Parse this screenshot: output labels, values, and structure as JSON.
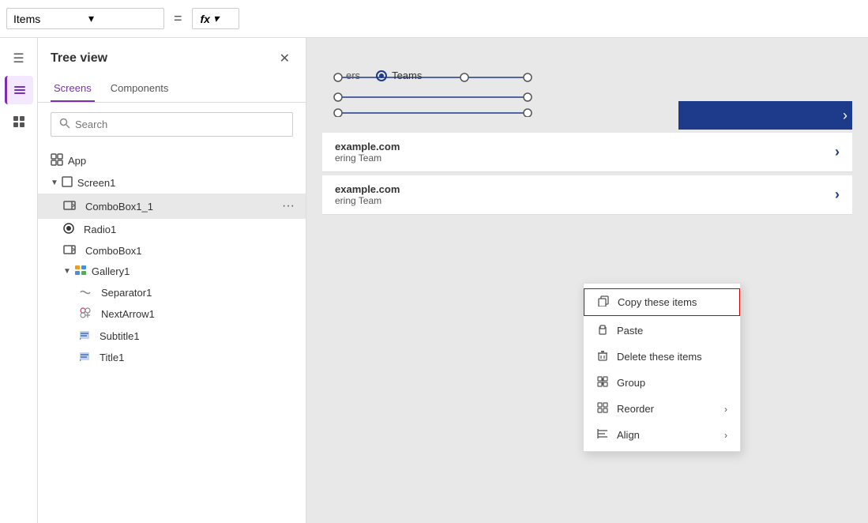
{
  "topbar": {
    "items_label": "Items",
    "dropdown_arrow": "▾",
    "equals": "=",
    "fx_label": "fx",
    "fx_arrow": "▾"
  },
  "tree_view": {
    "title": "Tree view",
    "tabs": [
      {
        "label": "Screens",
        "active": true
      },
      {
        "label": "Components",
        "active": false
      }
    ],
    "search_placeholder": "Search",
    "close_label": "✕",
    "items": [
      {
        "id": "app",
        "label": "App",
        "indent": 0,
        "type": "app",
        "icon": "⊞",
        "triangle": ""
      },
      {
        "id": "screen1",
        "label": "Screen1",
        "indent": 0,
        "type": "screen",
        "icon": "□",
        "triangle": "▼"
      },
      {
        "id": "combobox1_1",
        "label": "ComboBox1_1",
        "indent": 1,
        "type": "combobox",
        "icon": "⊟",
        "triangle": "",
        "more": "..."
      },
      {
        "id": "radio1",
        "label": "Radio1",
        "indent": 1,
        "type": "radio",
        "icon": "◉",
        "triangle": ""
      },
      {
        "id": "combobox1",
        "label": "ComboBox1",
        "indent": 1,
        "type": "combobox",
        "icon": "⊟",
        "triangle": ""
      },
      {
        "id": "gallery1",
        "label": "Gallery1",
        "indent": 1,
        "type": "gallery",
        "icon": "▦",
        "triangle": "▼"
      },
      {
        "id": "separator1",
        "label": "Separator1",
        "indent": 2,
        "type": "separator",
        "icon": "⋯",
        "triangle": ""
      },
      {
        "id": "nextarrow1",
        "label": "NextArrow1",
        "indent": 2,
        "type": "arrow",
        "icon": "✦",
        "triangle": ""
      },
      {
        "id": "subtitle1",
        "label": "Subtitle1",
        "indent": 2,
        "type": "subtitle",
        "icon": "✎",
        "triangle": ""
      },
      {
        "id": "title1",
        "label": "Title1",
        "indent": 2,
        "type": "title",
        "icon": "✎",
        "triangle": ""
      }
    ]
  },
  "context_menu": {
    "items": [
      {
        "id": "copy",
        "label": "Copy these items",
        "icon": "copy",
        "arrow": "",
        "highlighted": true
      },
      {
        "id": "paste",
        "label": "Paste",
        "icon": "paste",
        "arrow": ""
      },
      {
        "id": "delete",
        "label": "Delete these items",
        "icon": "delete",
        "arrow": ""
      },
      {
        "id": "group",
        "label": "Group",
        "icon": "group",
        "arrow": ""
      },
      {
        "id": "reorder",
        "label": "Reorder",
        "icon": "reorder",
        "arrow": "›"
      },
      {
        "id": "align",
        "label": "Align",
        "icon": "align",
        "arrow": "›"
      }
    ]
  },
  "canvas": {
    "radio_options": [
      "ers",
      "Teams"
    ],
    "list_rows": [
      {
        "domain": "example.com",
        "team": "ering Team"
      },
      {
        "domain": "example.com",
        "team": "ering Team"
      }
    ]
  }
}
